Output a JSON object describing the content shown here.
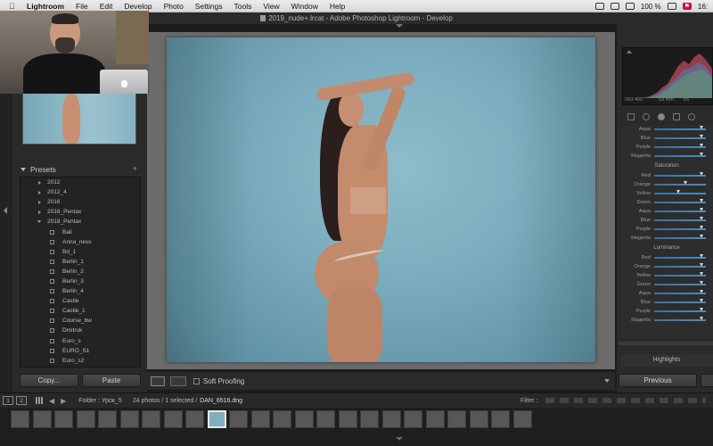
{
  "menubar": {
    "app": "Lightroom",
    "items": [
      "File",
      "Edit",
      "Develop",
      "Photo",
      "Settings",
      "Tools",
      "View",
      "Window",
      "Help"
    ],
    "battery": "100 %",
    "time": "16:"
  },
  "window": {
    "title": "2019_nude+.lrcat - Adobe Photoshop Lightroom - Develop"
  },
  "left_panel": {
    "presets_title": "Presets",
    "presets": [
      {
        "label": "2012",
        "type": "folder",
        "open": false
      },
      {
        "label": "2012_4",
        "type": "folder",
        "open": false
      },
      {
        "label": "2016",
        "type": "folder",
        "open": false
      },
      {
        "label": "2016_Pentax",
        "type": "folder",
        "open": false
      },
      {
        "label": "2018_Pentax",
        "type": "folder",
        "open": true
      },
      {
        "label": "Bali",
        "type": "preset"
      },
      {
        "label": "Anna_ness",
        "type": "preset"
      },
      {
        "label": "Bd_1",
        "type": "preset"
      },
      {
        "label": "Berlin_1",
        "type": "preset"
      },
      {
        "label": "Berlin_2",
        "type": "preset"
      },
      {
        "label": "Berlin_3",
        "type": "preset"
      },
      {
        "label": "Berlin_4",
        "type": "preset"
      },
      {
        "label": "Castle",
        "type": "preset"
      },
      {
        "label": "Castle_1",
        "type": "preset"
      },
      {
        "label": "Course_bw",
        "type": "preset"
      },
      {
        "label": "Dmitruk",
        "type": "preset"
      },
      {
        "label": "Euro_s",
        "type": "preset"
      },
      {
        "label": "EURO_S1",
        "type": "preset"
      },
      {
        "label": "Euro_s2",
        "type": "preset"
      }
    ],
    "copy_label": "Copy...",
    "paste_label": "Paste"
  },
  "center": {
    "soft_proofing_label": "Soft Proofing"
  },
  "right_panel": {
    "histogram": {
      "iso": "ISO 400",
      "focal": "53 mm",
      "aperture": "f/5"
    },
    "hsl": {
      "top_rows": [
        {
          "label": "Aqua",
          "value": 0.92
        },
        {
          "label": "Blue",
          "value": 0.92
        },
        {
          "label": "Purple",
          "value": 0.92
        },
        {
          "label": "Magenta",
          "value": 0.92
        }
      ],
      "saturation_title": "Saturation",
      "saturation_rows": [
        {
          "label": "Red",
          "value": 0.92
        },
        {
          "label": "Orange",
          "value": 0.62
        },
        {
          "label": "Yellow",
          "value": 0.48
        },
        {
          "label": "Green",
          "value": 0.92
        },
        {
          "label": "Aqua",
          "value": 0.92
        },
        {
          "label": "Blue",
          "value": 0.92
        },
        {
          "label": "Purple",
          "value": 0.92
        },
        {
          "label": "Magenta",
          "value": 0.92
        }
      ],
      "luminance_title": "Luminance",
      "luminance_rows": [
        {
          "label": "Red",
          "value": 0.92
        },
        {
          "label": "Orange",
          "value": 0.92
        },
        {
          "label": "Yellow",
          "value": 0.92
        },
        {
          "label": "Green",
          "value": 0.92
        },
        {
          "label": "Aqua",
          "value": 0.92
        },
        {
          "label": "Blue",
          "value": 0.92
        },
        {
          "label": "Purple",
          "value": 0.92
        },
        {
          "label": "Magenta",
          "value": 0.92
        }
      ]
    },
    "highlights_label": "Highlights",
    "previous_label": "Previous"
  },
  "filmstrip": {
    "page1": "1",
    "page2": "2",
    "folder": "Folder : Урок_5",
    "count": "24 photos / 1 selected /",
    "file": "DAN_6516.dng",
    "filter_label": "Filter :",
    "selected_index": 9,
    "thumb_count": 24
  }
}
